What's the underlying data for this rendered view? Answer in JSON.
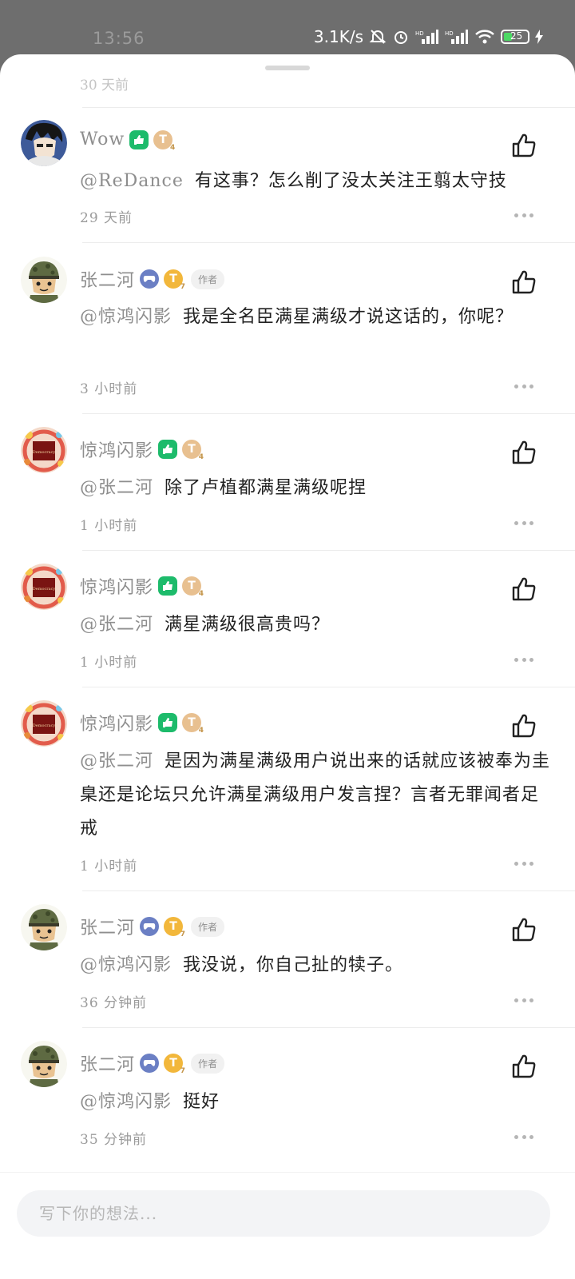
{
  "status_bar": {
    "time": "13:56",
    "net_speed": "3.1K/s",
    "battery_level": "25"
  },
  "ghost_time": "30 天前",
  "comments": [
    {
      "user": "Wow",
      "badges": [
        "green",
        "t"
      ],
      "author": false,
      "mention": "@ReDance",
      "text": "有这事？怎么削了没太关注王翦太守技",
      "time": "29 天前",
      "avatar": "anime-avatar"
    },
    {
      "user": "张二河",
      "badges": [
        "blue",
        "tgold"
      ],
      "author": true,
      "author_label": "作者",
      "mention": "@惊鸿闪影",
      "text": "我是全名臣满星满级才说这话的，你呢？",
      "time": "3 小时前",
      "avatar": "soldier-avatar"
    },
    {
      "user": "惊鸿闪影",
      "badges": [
        "green",
        "t"
      ],
      "author": false,
      "mention": "@张二河",
      "text": "除了卢植都满星满级呢捏",
      "time": "1 小时前",
      "avatar": "democracy-avatar"
    },
    {
      "user": "惊鸿闪影",
      "badges": [
        "green",
        "t"
      ],
      "author": false,
      "mention": "@张二河",
      "text": "满星满级很高贵吗？",
      "time": "1 小时前",
      "avatar": "democracy-avatar"
    },
    {
      "user": "惊鸿闪影",
      "badges": [
        "green",
        "t"
      ],
      "author": false,
      "mention": "@张二河",
      "text": "是因为满星满级用户说出来的话就应该被奉为圭臬还是论坛只允许满星满级用户发言捏？言者无罪闻者足戒",
      "time": "1 小时前",
      "avatar": "democracy-avatar"
    },
    {
      "user": "张二河",
      "badges": [
        "blue",
        "tgold"
      ],
      "author": true,
      "author_label": "作者",
      "mention": "@惊鸿闪影",
      "text": "我没说，你自己扯的犊子。",
      "time": "36 分钟前",
      "avatar": "soldier-avatar"
    },
    {
      "user": "张二河",
      "badges": [
        "blue",
        "tgold"
      ],
      "author": true,
      "author_label": "作者",
      "mention": "@惊鸿闪影",
      "text": "挺好",
      "time": "35 分钟前",
      "avatar": "soldier-avatar"
    }
  ],
  "input": {
    "placeholder": "写下你的想法..."
  },
  "icons": {
    "like": "thumbs-up-icon",
    "more": "more-dots-icon"
  },
  "colors": {
    "name": "#8e8e8e",
    "text": "#222222",
    "badge_green": "#1dbb6b",
    "badge_blue": "#6b7fc4"
  }
}
